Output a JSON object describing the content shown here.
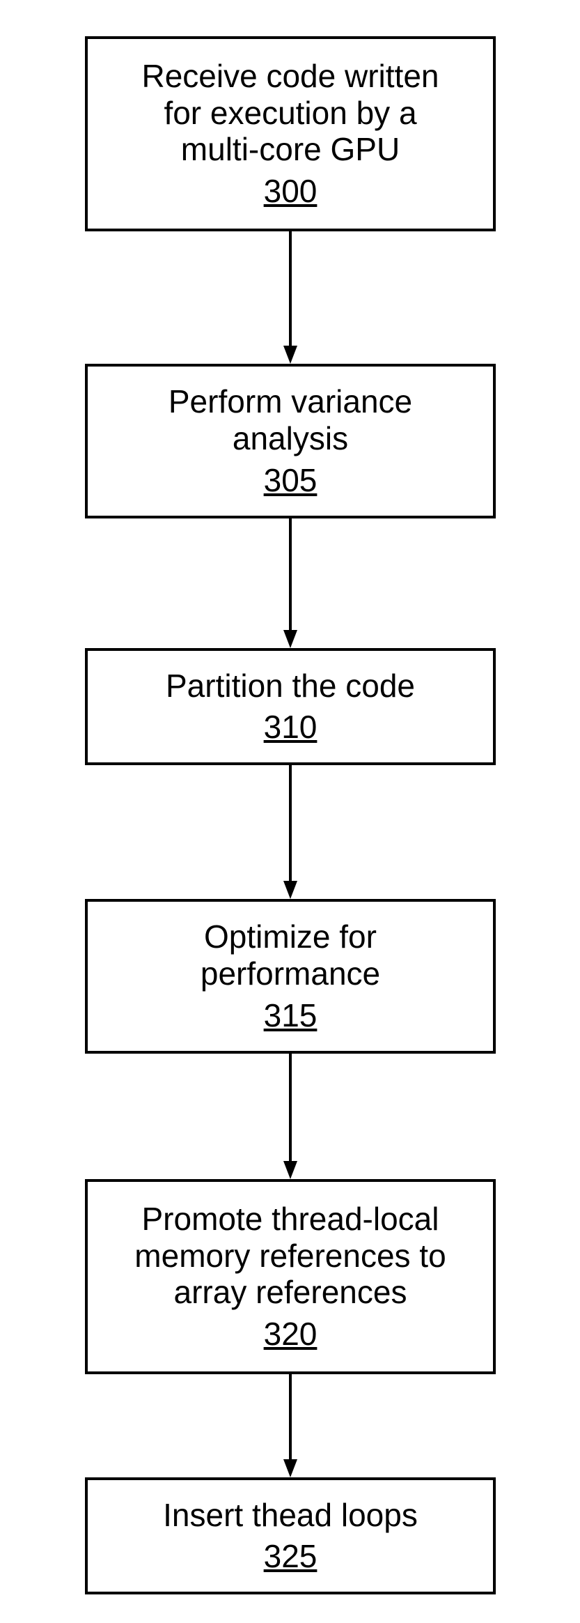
{
  "chart_data": {
    "type": "flowchart",
    "direction": "top-to-bottom",
    "nodes": [
      {
        "id": "n300",
        "label": "Receive code written\nfor execution by a\nmulti-core GPU",
        "ref": "300"
      },
      {
        "id": "n305",
        "label": "Perform variance\nanalysis",
        "ref": "305"
      },
      {
        "id": "n310",
        "label": "Partition the code",
        "ref": "310"
      },
      {
        "id": "n315",
        "label": "Optimize for\nperformance",
        "ref": "315"
      },
      {
        "id": "n320",
        "label": "Promote thread-local\nmemory references to\narray references",
        "ref": "320"
      },
      {
        "id": "n325",
        "label": "Insert thead loops",
        "ref": "325"
      }
    ],
    "edges": [
      {
        "from": "n300",
        "to": "n305"
      },
      {
        "from": "n305",
        "to": "n310"
      },
      {
        "from": "n310",
        "to": "n315"
      },
      {
        "from": "n315",
        "to": "n320"
      },
      {
        "from": "n320",
        "to": "n325"
      }
    ]
  }
}
